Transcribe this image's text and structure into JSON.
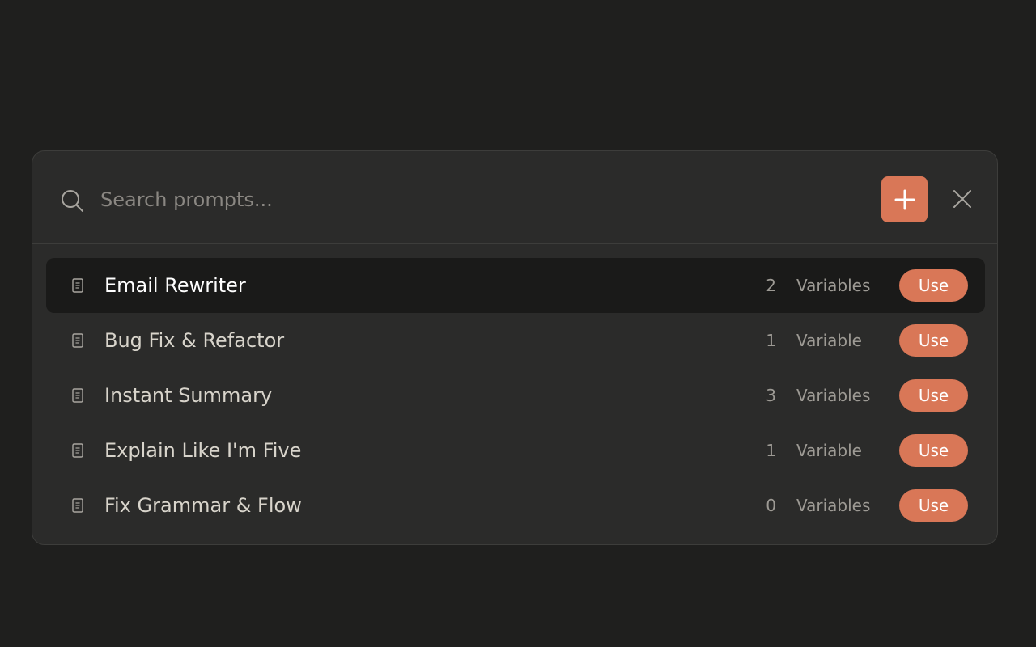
{
  "search": {
    "placeholder": "Search prompts...",
    "value": "",
    "icon": "search-icon"
  },
  "toolbar": {
    "add_icon": "plus-icon",
    "close_icon": "close-icon"
  },
  "prompts": [
    {
      "title": "Email Rewriter",
      "count": "2",
      "variables_label": "Variables",
      "use_label": "Use",
      "selected": true,
      "icon": "document-icon"
    },
    {
      "title": "Bug Fix & Refactor",
      "count": "1",
      "variables_label": "Variable",
      "use_label": "Use",
      "selected": false,
      "icon": "document-icon"
    },
    {
      "title": "Instant Summary",
      "count": "3",
      "variables_label": "Variables",
      "use_label": "Use",
      "selected": false,
      "icon": "document-icon"
    },
    {
      "title": "Explain Like I'm Five",
      "count": "1",
      "variables_label": "Variable",
      "use_label": "Use",
      "selected": false,
      "icon": "document-icon"
    },
    {
      "title": "Fix Grammar & Flow",
      "count": "0",
      "variables_label": "Variables",
      "use_label": "Use",
      "selected": false,
      "icon": "document-icon"
    }
  ],
  "colors": {
    "background": "#1f1f1e",
    "panel": "#2b2b2a",
    "accent": "#d97757",
    "selected_row": "#1a1a19"
  }
}
